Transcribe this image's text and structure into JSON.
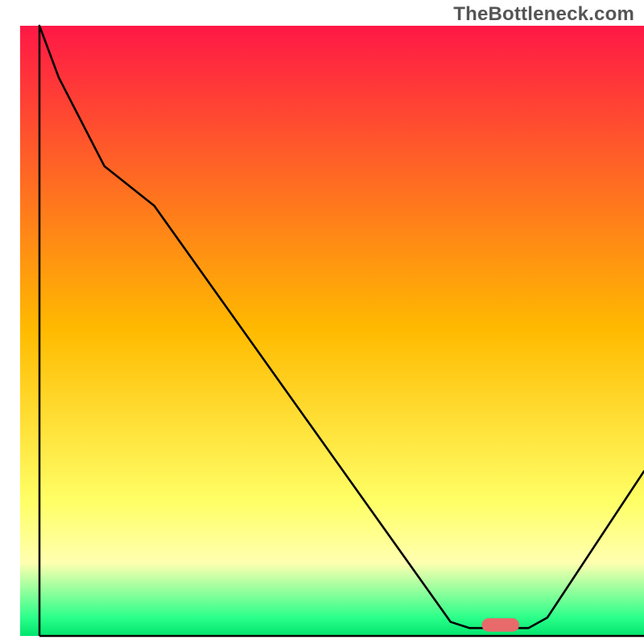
{
  "watermark": "TheBottleneck.com",
  "chart_data": {
    "type": "line",
    "title": "",
    "xlabel": "",
    "ylabel": "",
    "xlim": [
      0,
      100
    ],
    "ylim": [
      0,
      100
    ],
    "background_gradient": [
      {
        "y": 100,
        "color": "#ff1846"
      },
      {
        "y": 50,
        "color": "#ffbb00"
      },
      {
        "y": 22,
        "color": "#ffff66"
      },
      {
        "y": 12,
        "color": "#ffffb0"
      },
      {
        "y": 3,
        "color": "#2bff8a"
      },
      {
        "y": 0,
        "color": "#00e56d"
      }
    ],
    "series": [
      {
        "name": "bottleneck-curve",
        "x": [
          3.1,
          6.2,
          13.5,
          21.5,
          69.0,
          72.0,
          81.5,
          84.5,
          100.0
        ],
        "y": [
          100.0,
          91.5,
          77.0,
          70.5,
          2.3,
          1.3,
          1.3,
          3.0,
          27.0
        ]
      }
    ],
    "marker": {
      "name": "optimum-pill",
      "x_center": 77.0,
      "y_center": 1.8,
      "width": 6.0,
      "height": 2.2,
      "color": "#e86a6a"
    },
    "axes": {
      "left": {
        "x": 3.1,
        "y0": 0,
        "y1": 100
      },
      "bottom": {
        "y": 0.0,
        "x0": 3.1,
        "x1": 100
      }
    }
  }
}
